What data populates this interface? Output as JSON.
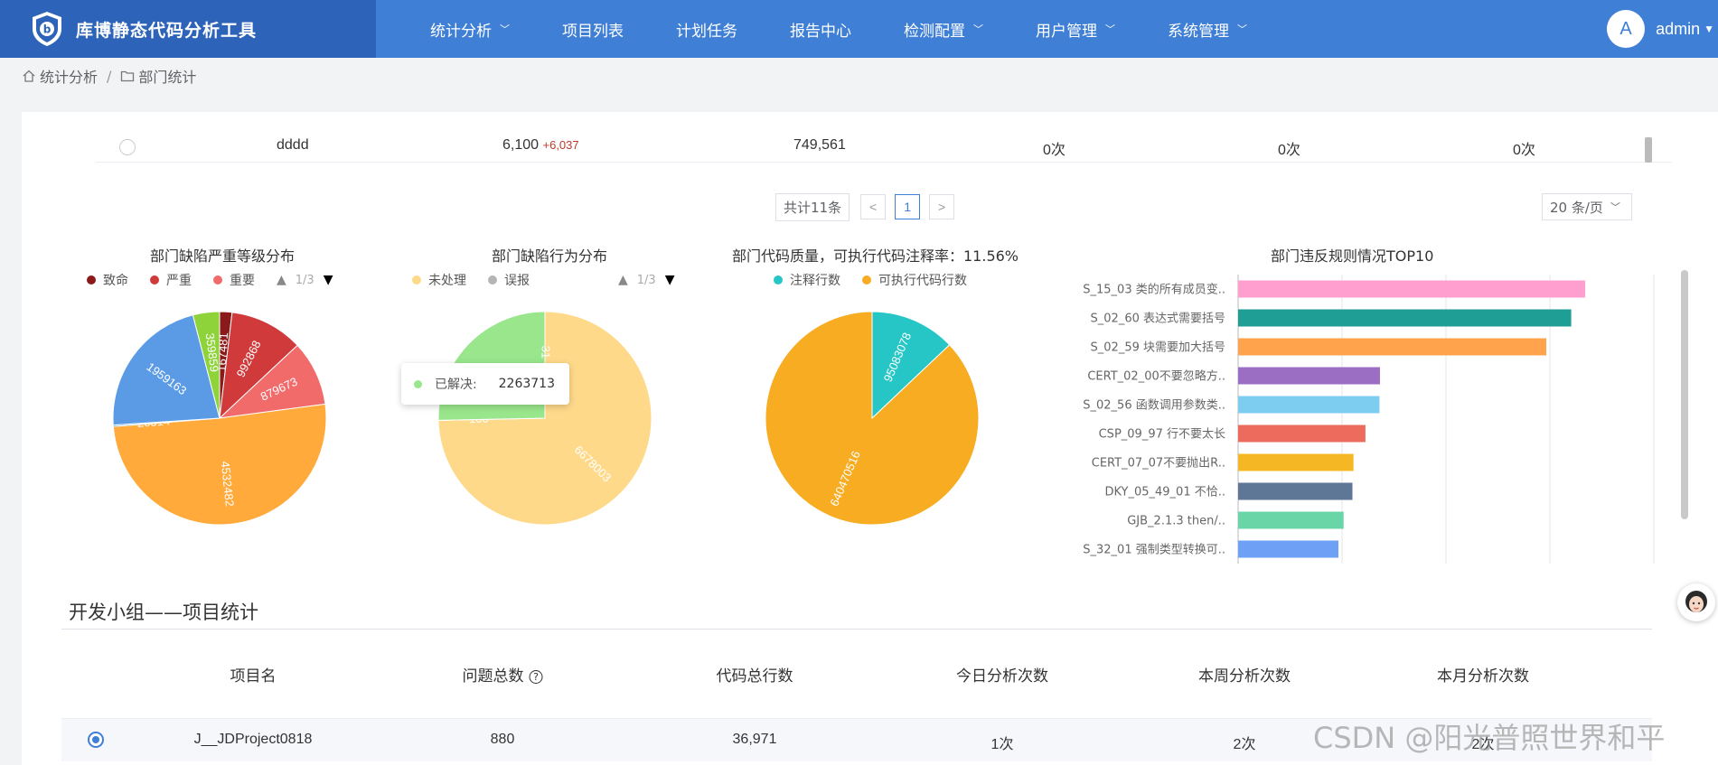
{
  "header": {
    "app_title": "库博静态代码分析工具",
    "nav": [
      {
        "label": "统计分析",
        "dropdown": true
      },
      {
        "label": "项目列表",
        "dropdown": false
      },
      {
        "label": "计划任务",
        "dropdown": false
      },
      {
        "label": "报告中心",
        "dropdown": false
      },
      {
        "label": "检测配置",
        "dropdown": true
      },
      {
        "label": "用户管理",
        "dropdown": true
      },
      {
        "label": "系统管理",
        "dropdown": true
      }
    ],
    "avatar_letter": "A",
    "username": "admin",
    "brand_color": "#2d63b8",
    "accent_color": "#3f7fd6"
  },
  "breadcrumb": {
    "root": "统计分析",
    "current": "部门统计",
    "separator": "/"
  },
  "top_row": {
    "name": "dddd",
    "issues": "6,100",
    "issues_delta": "+6,037",
    "lines": "749,561",
    "today": "0次",
    "week": "0次",
    "month": "0次"
  },
  "pagination": {
    "total": "共计11条",
    "prev": "<",
    "page": "1",
    "next": ">",
    "page_size": "20 条/页"
  },
  "charts": {
    "severity": {
      "title": "部门缺陷严重等级分布",
      "legend": [
        "致命",
        "严重",
        "重要"
      ],
      "legend_colors": [
        "#8b1a1a",
        "#d03a3a",
        "#f26b6b"
      ],
      "legend_page": "1/3",
      "slice_labels": [
        "167481",
        "992868",
        "879673",
        "4532482",
        "20314",
        "1959163",
        "359859"
      ]
    },
    "behavior": {
      "title": "部门缺陷行为分布",
      "legend": [
        "未处理",
        "误报"
      ],
      "legend_colors": [
        "#ffd98a",
        "#b5b5b5"
      ],
      "legend_page": "1/3",
      "slice_labels": [
        "6678003",
        "100",
        "31"
      ],
      "tooltip": {
        "label": "已解决:",
        "value": "2263713"
      }
    },
    "quality": {
      "title": "部门代码质量，可执行代码注释率：11.56%",
      "legend": [
        "注释行数",
        "可执行代码行数"
      ],
      "legend_colors": [
        "#26c6c6",
        "#f7ac22"
      ],
      "slice_labels": [
        "95083078",
        "640470516"
      ]
    },
    "violations": {
      "title": "部门违反规则情况TOP10"
    }
  },
  "chart_data": [
    {
      "type": "pie",
      "title": "部门缺陷严重等级分布",
      "labels": [
        "致命",
        "严重",
        "重要",
        "",
        "",
        "",
        ""
      ],
      "values": [
        167481,
        992868,
        879673,
        4532482,
        20314,
        1959163,
        359859
      ],
      "colors": [
        "#8b1a1a",
        "#d03a3a",
        "#f26b6b",
        "#ffaa3a",
        "#3a9ad6",
        "#5b9be6",
        "#8fd33b"
      ]
    },
    {
      "type": "pie",
      "title": "部门缺陷行为分布",
      "labels": [
        "未处理",
        "误报",
        "已解决"
      ],
      "values": [
        6678003,
        100,
        2263713,
        31
      ],
      "colors": [
        "#ffd98a",
        "#b5b5b5",
        "#99e68c",
        "#99e68c"
      ]
    },
    {
      "type": "pie",
      "title": "部门代码质量，可执行代码注释率：11.56%",
      "labels": [
        "注释行数",
        "可执行代码行数"
      ],
      "values": [
        95083078,
        640470516
      ],
      "colors": [
        "#26c6c6",
        "#f7ac22"
      ]
    },
    {
      "type": "bar",
      "orientation": "horizontal",
      "title": "部门违反规则情况TOP10",
      "categories": [
        "S_15_03 类的所有成员变..",
        "S_02_60 表达式需要括号",
        "S_02_59 块需要加大括号",
        "CERT_02_00不要忽略方..",
        "S_02_56 函数调用参数类..",
        "CSP_09_97 行不要太长",
        "CERT_07_07不要抛出R..",
        "DKY_05_49_01 不恰..",
        "GJB_2.1.3 then/..",
        "S_32_01 强制类型转换可.."
      ],
      "values": [
        668000,
        641000,
        593000,
        273000,
        272000,
        245000,
        222000,
        220000,
        203000,
        193000
      ],
      "colors": [
        "#ff9fd0",
        "#1f9e96",
        "#ffa34d",
        "#9b6ec4",
        "#7dcdf0",
        "#ed6b5c",
        "#f5b824",
        "#5e7796",
        "#6ad6a8",
        "#6ea0f5"
      ],
      "x_ticks": [
        "0",
        "200000",
        "400000",
        "600000",
        "800000"
      ],
      "xlim": [
        0,
        800000
      ]
    }
  ],
  "team_section": {
    "title": "开发小组——项目统计",
    "columns": [
      "项目名",
      "问题总数",
      "代码总行数",
      "今日分析次数",
      "本周分析次数",
      "本月分析次数"
    ],
    "help_glyph": "?",
    "rows": [
      {
        "name": "J__JDProject0818",
        "issues": "880",
        "lines": "36,971",
        "today": "1次",
        "week": "2次",
        "month": "2次"
      }
    ]
  },
  "watermark": "CSDN @阳光普照世界和平"
}
